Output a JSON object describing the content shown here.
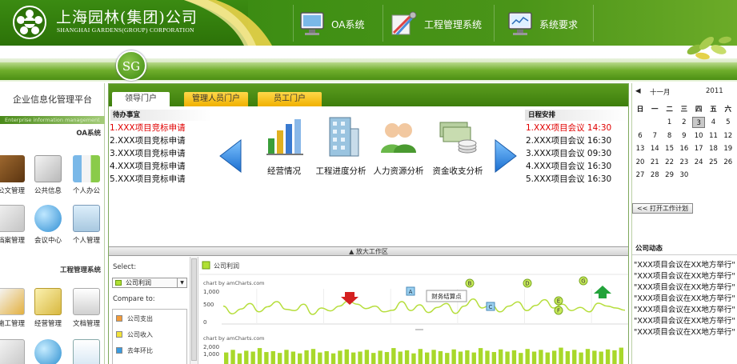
{
  "header": {
    "company_cn": "上海园林(集团)公司",
    "company_en": "SHANGHAI GARDENS(GROUP) CORPORATION",
    "nav": [
      {
        "label": "OA系统",
        "icon": "monitor-icon"
      },
      {
        "label": "工程管理系统",
        "icon": "tools-icon"
      },
      {
        "label": "系统要求",
        "icon": "monitor-chart-icon"
      }
    ],
    "badge": "SG"
  },
  "sidebar": {
    "title": "企业信息化管理平台",
    "strip": "Enterprise information management",
    "oa_section": "OA系统",
    "oa_items": [
      "公文管理",
      "公共信息",
      "个人办公",
      "档案管理",
      "会议中心",
      "个人管理"
    ],
    "eng_section": "工程管理系统",
    "eng_items": [
      "施工管理",
      "经营管理",
      "文档管理"
    ]
  },
  "tabs": [
    "领导门户",
    "管理人员门户",
    "员工门户"
  ],
  "todo": {
    "title": "待办事宜",
    "items": [
      "1.XXX项目竞标申请",
      "2.XXX项目竞标申请",
      "3.XXX项目竞标申请",
      "4.XXX项目竞标申请",
      "5.XXX项目竞标申请"
    ]
  },
  "functions": [
    "经营情况",
    "工程进度分析",
    "人力资源分析",
    "资金收支分析"
  ],
  "schedule": {
    "title": "日程安排",
    "items": [
      "1.XXX项目会议 14:30",
      "2.XXX项目会议 16:30",
      "3.XXX项目会议 09:30",
      "4.XXX项目会议 16:30",
      "5.XXX项目会议 16:30"
    ]
  },
  "expand_label": "▲ 放大工作区",
  "chart_panel": {
    "select_label": "Select:",
    "select_value": "公司利润",
    "compare_label": "Compare to:",
    "compare_items": [
      {
        "label": "公司支出",
        "color": "#f29b3a"
      },
      {
        "label": "公司收入",
        "color": "#f2e23a"
      },
      {
        "label": "去年环比",
        "color": "#3a9be0"
      }
    ]
  },
  "chart_data": {
    "type": "line",
    "legend": "公司利润",
    "credit_top": "chart by amCharts.com",
    "credit_bottom": "chart by amCharts.com",
    "ylabels_top": [
      "1,000",
      "500",
      "0"
    ],
    "ylabels_bottom": [
      "2,000",
      "1,000"
    ],
    "line_color": "#b6de3c",
    "bar_color": "#a8d82a",
    "callout": "财务结算点",
    "markers": [
      "B",
      "D",
      "G",
      "A",
      "C",
      "E",
      "F"
    ],
    "line_values": [
      560,
      320,
      470,
      640,
      380,
      540,
      700,
      460,
      420,
      620,
      300,
      500,
      410,
      560,
      720,
      620,
      480,
      560,
      380,
      430,
      700,
      420,
      600,
      360,
      520,
      640,
      330,
      560,
      780,
      500,
      620,
      380,
      560,
      690,
      420,
      580,
      760,
      500,
      620,
      420,
      520,
      380,
      650,
      560,
      500,
      430
    ],
    "bar_values": [
      1400,
      1700,
      1300,
      1600,
      1500,
      1900,
      1450,
      1550,
      1350,
      1700,
      1500,
      1300,
      1650,
      1800,
      1400,
      1550,
      1300,
      1600,
      1750,
      1400,
      1500,
      1700,
      1350,
      1600,
      1450,
      1900,
      1500,
      1650,
      1300,
      1800,
      1400,
      1700,
      1550,
      1350,
      1750,
      1500,
      1650,
      1400,
      1900,
      1600,
      1450,
      1750,
      1500,
      1650,
      1350,
      1800,
      1500,
      1700,
      1400,
      1600,
      1950,
      1550,
      1700,
      1400,
      1800,
      1600,
      1500,
      1750,
      1650,
      1950
    ]
  },
  "calendar": {
    "month": "十一月",
    "year": "2011",
    "dows": [
      "日",
      "一",
      "二",
      "三",
      "四",
      "五",
      "六"
    ],
    "weeks": [
      [
        "",
        "",
        "1",
        "2",
        "3",
        "4",
        "5"
      ],
      [
        "6",
        "7",
        "8",
        "9",
        "10",
        "11",
        "12"
      ],
      [
        "13",
        "14",
        "15",
        "16",
        "17",
        "18",
        "19"
      ],
      [
        "20",
        "21",
        "22",
        "23",
        "24",
        "25",
        "26"
      ],
      [
        "27",
        "28",
        "29",
        "30",
        "",
        "",
        ""
      ]
    ],
    "today": "3",
    "plan_button": "<< 打开工作计划"
  },
  "news": {
    "title": "公司动态",
    "items": [
      "\"XXX项目会议在XX地方举行\"",
      "\"XXX项目会议在XX地方举行\"",
      "\"XXX项目会议在XX地方举行\"",
      "\"XXX项目会议在XX地方举行\"",
      "\"XXX项目会议在XX地方举行\"",
      "\"XXX项目会议在XX地方举行\"",
      "\"XXX项目会议在XX地方举行\""
    ]
  }
}
